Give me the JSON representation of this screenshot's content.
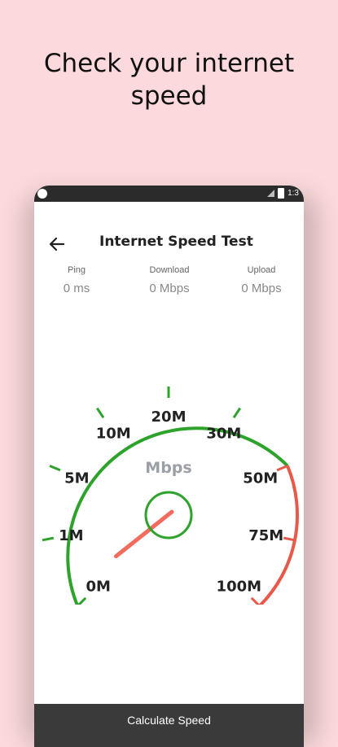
{
  "headline": {
    "line1": "Check your internet",
    "line2": "speed"
  },
  "status_bar": {
    "time": "1:3"
  },
  "app": {
    "title": "Internet Speed Test",
    "back_icon": "arrow-left-icon"
  },
  "stats": [
    {
      "label": "Ping",
      "value": "0 ms"
    },
    {
      "label": "Download",
      "value": "0 Mbps"
    },
    {
      "label": "Upload",
      "value": "0 Mbps"
    }
  ],
  "gauge": {
    "unit": "Mbps",
    "labels": [
      "0M",
      "1M",
      "5M",
      "10M",
      "20M",
      "30M",
      "50M",
      "75M",
      "100M"
    ],
    "current_speed": 0,
    "colors": {
      "normal": "#2ea32b",
      "high": "#e8594a",
      "needle": "#f46b5d"
    }
  },
  "action": {
    "label": "Calculate Speed"
  }
}
